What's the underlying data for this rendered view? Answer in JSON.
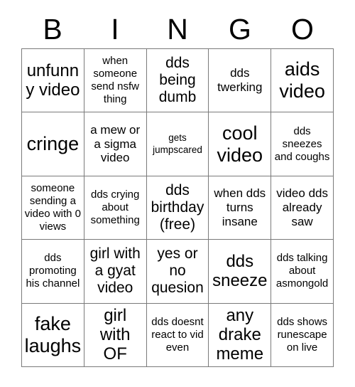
{
  "card": {
    "title": "BINGO",
    "header_letters": [
      "B",
      "I",
      "N",
      "G",
      "O"
    ],
    "grid_size": "5x5",
    "free_space_label": "dds birthday (free)",
    "colors": {
      "background": "#ffffff",
      "text": "#000000",
      "grid_line": "#7a7a7a"
    },
    "rows": [
      [
        {
          "text": "unfunny video",
          "size": "lg"
        },
        {
          "text": "when someone send nsfw thing",
          "size": "xs"
        },
        {
          "text": "dds being dumb",
          "size": "md"
        },
        {
          "text": "dds twerking",
          "size": "sm"
        },
        {
          "text": "aids video",
          "size": "xl"
        }
      ],
      [
        {
          "text": "cringe",
          "size": "xl"
        },
        {
          "text": "a mew or a sigma video",
          "size": "sm"
        },
        {
          "text": "gets jumpscared",
          "size": "xxs"
        },
        {
          "text": "cool video",
          "size": "xl"
        },
        {
          "text": "dds sneezes and coughs",
          "size": "xs"
        }
      ],
      [
        {
          "text": "someone sending a video with 0 views",
          "size": "xs"
        },
        {
          "text": "dds crying about something",
          "size": "xs"
        },
        {
          "text": "dds birthday (free)",
          "size": "md"
        },
        {
          "text": "when dds turns insane",
          "size": "sm"
        },
        {
          "text": "video dds already saw",
          "size": "sm"
        }
      ],
      [
        {
          "text": "dds promoting his channel",
          "size": "xs"
        },
        {
          "text": "girl with a gyat video",
          "size": "md"
        },
        {
          "text": "yes or no quesion",
          "size": "md"
        },
        {
          "text": "dds sneeze",
          "size": "lg"
        },
        {
          "text": "dds talking about asmongold",
          "size": "xs"
        }
      ],
      [
        {
          "text": "fake laughs",
          "size": "xl"
        },
        {
          "text": "girl with OF",
          "size": "lg"
        },
        {
          "text": "dds doesnt react to vid even",
          "size": "xs"
        },
        {
          "text": "any drake meme",
          "size": "lg"
        },
        {
          "text": "dds shows runescape on live",
          "size": "xs"
        }
      ]
    ]
  }
}
